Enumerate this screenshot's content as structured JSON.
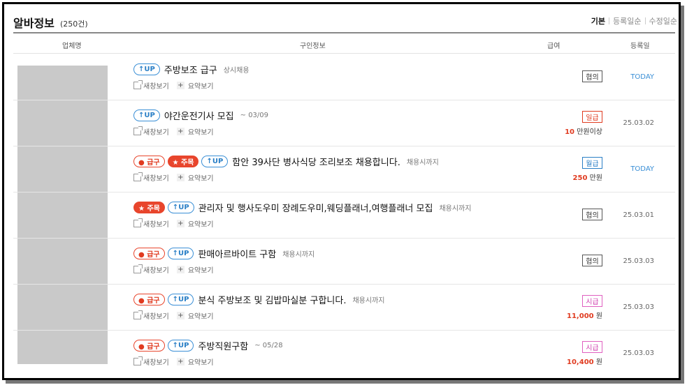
{
  "header": {
    "title": "알바정보",
    "count": "(250건)",
    "sort": [
      "기본",
      "등록일순",
      "수정일순"
    ]
  },
  "columns": {
    "company": "업체명",
    "info": "구인정보",
    "pay": "급여",
    "date": "등록일"
  },
  "actions": {
    "new_window": "새창보기",
    "summary": "요약보기"
  },
  "badges": {
    "up": "↑UP",
    "urgent": "● 급구",
    "focus": "★ 주목"
  },
  "rows": [
    {
      "title": "주방보조 급구",
      "sub": "상시채용",
      "pay_type": "협의",
      "amount_num": "",
      "amount_unit": "",
      "date": "TODAY"
    },
    {
      "title": "야간운전기사 모집",
      "sub": "~ 03/09",
      "pay_type": "일급",
      "amount_num": "10",
      "amount_unit": " 만원이상",
      "date": "25.03.02"
    },
    {
      "title": "함안 39사단 병사식당 조리보조 채용합니다.",
      "sub": "채용시까지",
      "pay_type": "월급",
      "amount_num": "250",
      "amount_unit": " 만원",
      "date": "TODAY"
    },
    {
      "title": "관리자 및 행사도우미 장례도우미,웨딩플래너,여행플래너 모집",
      "sub": "채용시까지",
      "pay_type": "협의",
      "amount_num": "",
      "amount_unit": "",
      "date": "25.03.01"
    },
    {
      "title": "판매아르바이트 구함",
      "sub": "채용시까지",
      "pay_type": "협의",
      "amount_num": "",
      "amount_unit": "",
      "date": "25.03.03"
    },
    {
      "title": "분식 주방보조 및 김밥마실분 구합니다.",
      "sub": "채용시까지",
      "pay_type": "시급",
      "amount_num": "11,000",
      "amount_unit": " 원",
      "date": "25.03.03"
    },
    {
      "title": "주방직원구함",
      "sub": "~ 05/28",
      "pay_type": "시급",
      "amount_num": "10,400",
      "amount_unit": " 원",
      "date": "25.03.03"
    }
  ]
}
